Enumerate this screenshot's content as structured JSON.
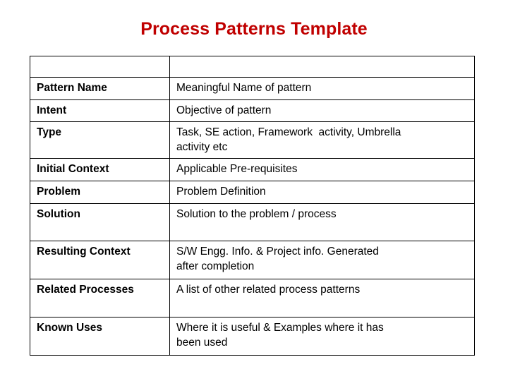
{
  "slide": {
    "title": "Process Patterns Template",
    "title_color": "#C00000",
    "background_color": "#FFFFFF",
    "border_color": "#000000"
  },
  "table": {
    "columns": 2,
    "header_row": {
      "label": "",
      "value": ""
    },
    "rows": [
      {
        "label": "Pattern Name",
        "lines": [
          "Meaningful Name of pattern"
        ]
      },
      {
        "label": "Intent",
        "lines": [
          "Objective of pattern"
        ]
      },
      {
        "label": "Type",
        "lines": [
          "Task, SE action, Framework  activity, Umbrella",
          "activity etc"
        ]
      },
      {
        "label": "Initial Context",
        "lines": [
          "Applicable Pre-requisites"
        ]
      },
      {
        "label": "Problem",
        "lines": [
          "Problem Definition"
        ]
      },
      {
        "label": "Solution",
        "lines": [
          "Solution to the problem / process"
        ]
      },
      {
        "label": "Resulting Context",
        "lines": [
          "S/W Engg. Info. & Project info. Generated",
          "after completion"
        ]
      },
      {
        "label": "Related Processes",
        "lines": [
          "A list of other related process patterns"
        ]
      },
      {
        "label": "Known Uses",
        "lines": [
          "Where it is useful & Examples where it has",
          "been used"
        ]
      }
    ]
  }
}
